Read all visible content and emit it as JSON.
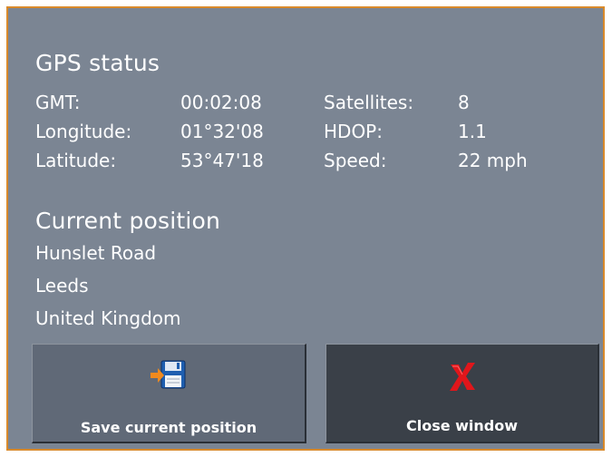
{
  "gps_status": {
    "title": "GPS status",
    "rows": [
      {
        "label1": "GMT:",
        "value1": "00:02:08",
        "label2": "Satellites:",
        "value2": "8"
      },
      {
        "label1": "Longitude:",
        "value1": "01°32'08",
        "label2": "HDOP:",
        "value2": "1.1"
      },
      {
        "label1": "Latitude:",
        "value1": "53°47'18",
        "label2": "Speed:",
        "value2": "22 mph"
      }
    ]
  },
  "current_position": {
    "title": "Current position",
    "lines": [
      "Hunslet Road",
      "Leeds",
      "United Kingdom"
    ]
  },
  "buttons": {
    "save": {
      "label": "Save current position",
      "icon": "save-floppy-icon"
    },
    "close": {
      "label": "Close window",
      "icon": "close-x-icon"
    }
  },
  "colors": {
    "panel_background": "#7b8593",
    "border_accent": "#d98a2b",
    "save_button": "#606977",
    "close_button": "#3a4048",
    "close_icon": "#e0161b",
    "arrow_icon": "#f08a1e"
  }
}
